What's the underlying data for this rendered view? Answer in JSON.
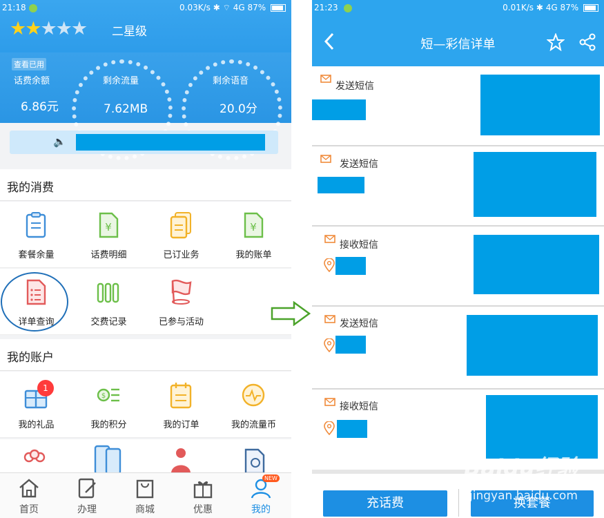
{
  "left": {
    "status": {
      "time": "21:18",
      "net": "0.03K/s",
      "signal": "4G",
      "battery": "87%"
    },
    "header": {
      "level": "二星级",
      "stars_on": 2,
      "stars_total": 5
    },
    "balance": {
      "check_used": "查看已用",
      "label": "话费余额",
      "value": "6.86元"
    },
    "data_gauge": {
      "label": "剩余流量",
      "value": "7.62MB"
    },
    "voice_gauge": {
      "label": "剩余语音",
      "value": "20.0分"
    },
    "consumption": {
      "title": "我的消费",
      "items": [
        "套餐余量",
        "话费明细",
        "已订业务",
        "我的账单",
        "详单查询",
        "交费记录",
        "已参与活动"
      ]
    },
    "account": {
      "title": "我的账户",
      "items": [
        "我的礼品",
        "我的积分",
        "我的订单",
        "我的流量币"
      ],
      "gift_badge": "1"
    },
    "tabs": [
      "首页",
      "办理",
      "商城",
      "优惠",
      "我的"
    ],
    "new_badge": "NEW"
  },
  "right": {
    "status": {
      "time": "21:23",
      "net": "0.01K/s",
      "signal": "4G",
      "battery": "87%"
    },
    "title": "短—彩信详单",
    "messages": [
      "发送短信",
      "发送短信",
      "接收短信",
      "发送短信",
      "接收短信"
    ],
    "buttons": {
      "recharge": "充话费",
      "change_plan": "换套餐"
    },
    "watermark": {
      "brand": "Baidu经验",
      "url": "jingyan.baidu.com"
    }
  },
  "colors": {
    "brand_blue": "#1d8fe3",
    "redaction": "#009ee6",
    "highlight_ring": "#1f6fb8"
  }
}
